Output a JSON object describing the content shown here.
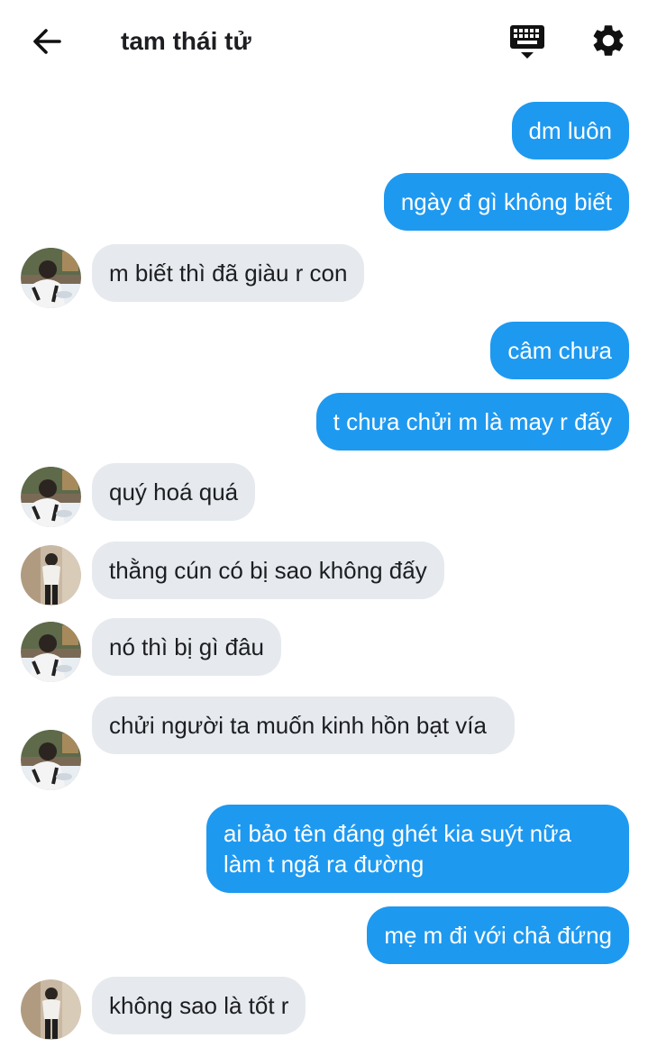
{
  "header": {
    "title": "tam thái tử",
    "back_icon": "arrow-left-icon",
    "keyboard_icon": "keyboard-icon",
    "settings_icon": "gear-icon"
  },
  "colors": {
    "outgoing_bubble": "#1e99f0",
    "incoming_bubble": "#e6e9ed",
    "text": "#1c1e21"
  },
  "messages": [
    {
      "direction": "out",
      "text": "dm luôn"
    },
    {
      "direction": "out",
      "text": "ngày đ gì không biết"
    },
    {
      "direction": "in",
      "avatar": "a",
      "text": "m biết thì đã giàu r con"
    },
    {
      "direction": "out",
      "text": "câm chưa"
    },
    {
      "direction": "out",
      "text": "t chưa chửi m là may r đấy"
    },
    {
      "direction": "in",
      "avatar": "a",
      "text": "quý hoá quá"
    },
    {
      "direction": "in",
      "avatar": "b",
      "text": "thằng cún có bị sao không đấy"
    },
    {
      "direction": "in",
      "avatar": "a",
      "text": "nó thì bị gì đâu"
    },
    {
      "direction": "in",
      "avatar": "a",
      "text": "chửi người ta muốn kinh hồn bạt vía"
    },
    {
      "direction": "out",
      "text": "ai bảo tên đáng ghét kia suýt nữa làm t ngã ra đường"
    },
    {
      "direction": "out",
      "text": "mẹ m đi với chả đứng"
    },
    {
      "direction": "in",
      "avatar": "b",
      "text": "không sao là tốt r"
    }
  ]
}
